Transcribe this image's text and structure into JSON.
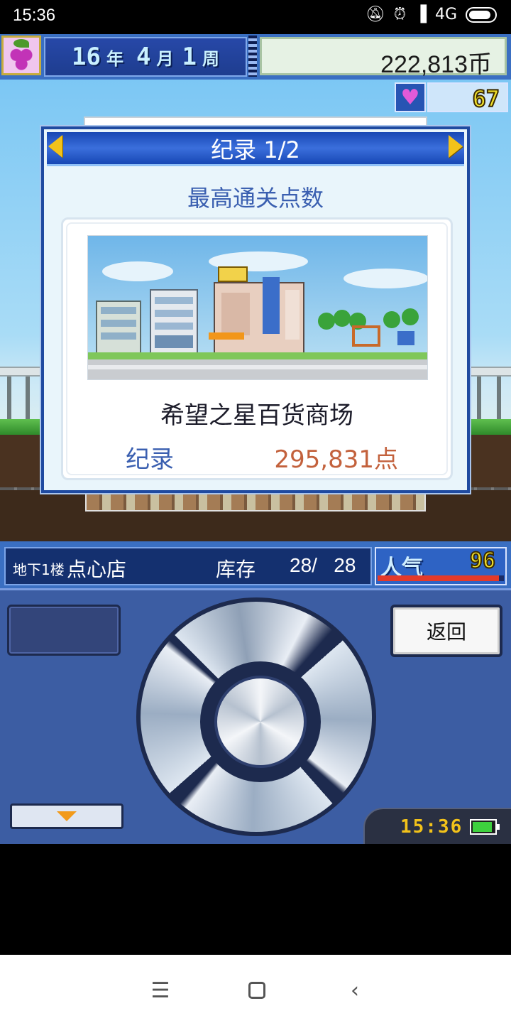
{
  "status_bar": {
    "time": "15:36",
    "network": "4G",
    "icons": [
      "mute-icon",
      "alarm-icon",
      "signal-icon",
      "network-4g-icon",
      "battery-icon"
    ]
  },
  "top_bar": {
    "year_num": "16",
    "year_unit": "年",
    "month_num": "4",
    "month_unit": "月",
    "week_num": "1",
    "week_unit": "周",
    "money": "222,813币",
    "heart_value": "67"
  },
  "dialog": {
    "title": "纪录 1/2",
    "subtitle": "最高通关点数",
    "store_name": "希望之星百货商场",
    "record_label": "纪录",
    "record_value": "295,831点"
  },
  "info_bar": {
    "floor": "地下1楼",
    "shop_name": "点心店",
    "stock_label": "库存",
    "stock_value": "28/   28",
    "popularity_label": "人气",
    "popularity_value": "96",
    "popularity_level": 0.96
  },
  "controller": {
    "back_label": "返回",
    "clock": "15:36",
    "battery_level": 0.9
  },
  "colors": {
    "accent_blue": "#3a6fc2",
    "dialog_header": "#1747b4",
    "record_value": "#c3613c",
    "label_blue": "#3a5fb0",
    "gold": "#f2c21a"
  }
}
